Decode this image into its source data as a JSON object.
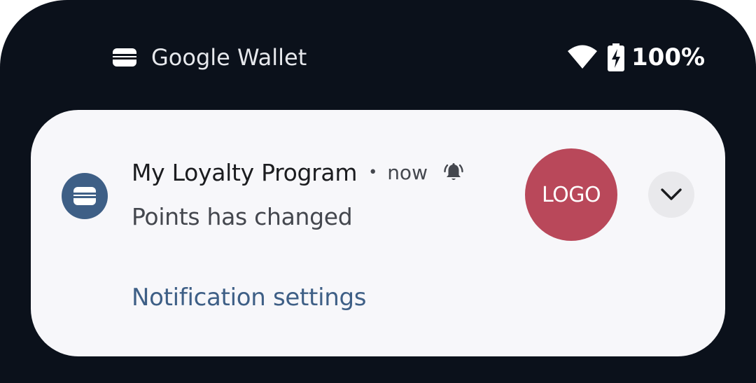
{
  "status_bar": {
    "app_icon": "wallet-icon",
    "app_name": "Google Wallet",
    "wifi_icon": "wifi-icon",
    "battery_icon": "battery-charging-icon",
    "battery_percent": "100%"
  },
  "notification": {
    "app_icon": "wallet-icon",
    "title": "My Loyalty Program",
    "separator": "•",
    "time": "now",
    "alert_icon": "bell-alert-icon",
    "body": "Points has changed",
    "logo_text": "LOGO",
    "expand_icon": "chevron-down-icon",
    "settings_link": "Notification settings"
  },
  "colors": {
    "background": "#0b111b",
    "card": "#f7f7fa",
    "accent": "#3e5f86",
    "logo_bg": "#b9485a"
  }
}
